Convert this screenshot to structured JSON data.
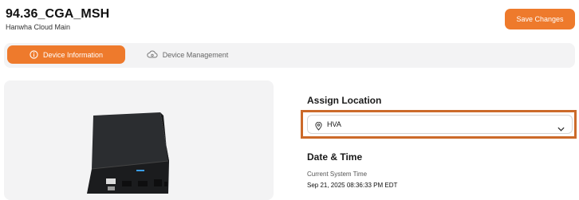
{
  "header": {
    "device_name": "94.36_CGA_MSH",
    "site_name": "Hanwha Cloud Main",
    "save_label": "Save Changes"
  },
  "tabs": [
    {
      "label": "Device Information",
      "icon": "info-icon",
      "active": true
    },
    {
      "label": "Device Management",
      "icon": "cloud-gear-icon",
      "active": false
    }
  ],
  "assign_location": {
    "title": "Assign Location",
    "selected": "HVA",
    "icon": "location-pin-icon"
  },
  "date_time": {
    "title": "Date & Time",
    "current_label": "Current System Time",
    "current_value": "Sep 21, 2025 08:36:33 PM EDT"
  },
  "colors": {
    "accent": "#ee7a2c",
    "highlight_border": "#cc6a2a",
    "panel_bg": "#f3f3f4"
  }
}
